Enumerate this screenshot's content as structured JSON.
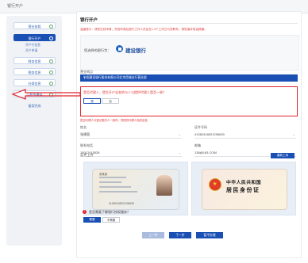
{
  "topbar": {
    "title": "银行开户"
  },
  "sidebar": {
    "steps": [
      {
        "label": "营业执照",
        "state": "done"
      },
      {
        "label": "银行开户",
        "state": "active"
      },
      {
        "label": "财务信息",
        "state": "done"
      },
      {
        "label": "税务信息",
        "state": "done"
      },
      {
        "label": "社保信息",
        "state": "done"
      },
      {
        "label": "公积金缴存",
        "state": "done"
      },
      {
        "label": "备案完成",
        "state": "plain"
      }
    ],
    "substeps": [
      "开户行信息",
      "开户申请"
    ]
  },
  "main": {
    "section_title": "银行开户",
    "notice": "温馨提示：请您在线申请，完成申请后银行工作人员会在1-3个工作日与您联系，请您保持电话畅通。",
    "bank_label": "您选择的银行为：",
    "bank_name": "建设银行",
    "branch_label": "营业网点",
    "branch_value": "中国建设银行股份有限公司北京西城支行营业部",
    "question": "是否代理人，提交开户业务的与人与提供代理人是否一致？",
    "yes_label": "是",
    "no_label": "否",
    "question_hint": "是否代理人与登记委托人一致时，须提供代理人相关信息",
    "fields": [
      {
        "label": "姓名",
        "value": "张建国",
        "dropdown": "⌄"
      },
      {
        "label": "证件号码",
        "value": "41282418921236630",
        "dropdown": "⌄"
      },
      {
        "label": "联系电话",
        "value": "15012415528",
        "dropdown": "⌄"
      },
      {
        "label": "邮箱",
        "value": "136@163.COM",
        "dropdown": "⌄"
      }
    ],
    "upload_label": "证件上传",
    "reupload_label": "重新上传",
    "id_front": {
      "name": "张某某",
      "id_number": "41282418921236630"
    },
    "id_back": {
      "title": "中华人民共和国",
      "subtitle": "居民身份证"
    },
    "auth_question": "是否需要了解银行授权服务？",
    "auth_yes": "需要",
    "auth_no": "不需要",
    "prev_label": "上一步",
    "next_label": "下一步",
    "save_label": "暂不办理"
  },
  "colors": {
    "primary": "#1a4fb4",
    "alert": "#e0232b",
    "sidebar_bg": "#f0f2f5"
  }
}
